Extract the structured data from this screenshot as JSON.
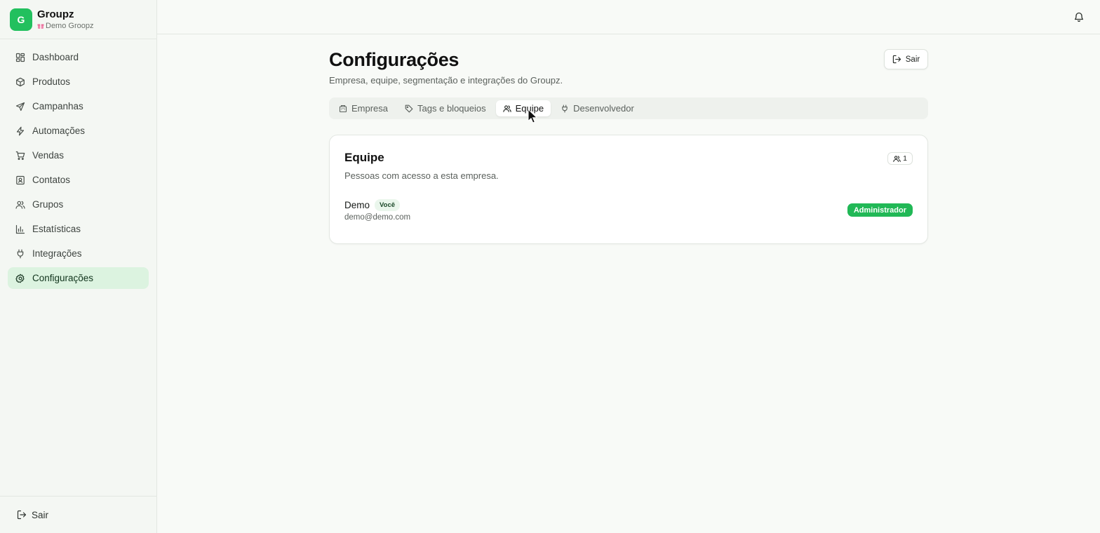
{
  "brand": {
    "logo_letter": "G",
    "name": "Groupz",
    "workspace": "Demo Groopz",
    "color": "#22c05e"
  },
  "sidebar": {
    "items": [
      {
        "label": "Dashboard",
        "icon": "dashboard-icon"
      },
      {
        "label": "Produtos",
        "icon": "package-icon"
      },
      {
        "label": "Campanhas",
        "icon": "send-icon"
      },
      {
        "label": "Automações",
        "icon": "zap-icon"
      },
      {
        "label": "Vendas",
        "icon": "cart-icon"
      },
      {
        "label": "Contatos",
        "icon": "contact-icon"
      },
      {
        "label": "Grupos",
        "icon": "users-icon"
      },
      {
        "label": "Estatísticas",
        "icon": "bar-chart-icon"
      },
      {
        "label": "Integrações",
        "icon": "plug-icon"
      },
      {
        "label": "Configurações",
        "icon": "gear-icon",
        "active": true
      }
    ],
    "footer_label": "Sair"
  },
  "page": {
    "title": "Configurações",
    "subtitle": "Empresa, equipe, segmentação e integrações do Groupz.",
    "logout_label": "Sair"
  },
  "tabs": [
    {
      "label": "Empresa",
      "icon": "building-icon"
    },
    {
      "label": "Tags e bloqueios",
      "icon": "tag-icon"
    },
    {
      "label": "Equipe",
      "icon": "users-icon",
      "active": true
    },
    {
      "label": "Desenvolvedor",
      "icon": "plug-icon"
    }
  ],
  "team": {
    "title": "Equipe",
    "description": "Pessoas com acesso a esta empresa.",
    "count": "1",
    "members": [
      {
        "name": "Demo",
        "you_label": "Você",
        "email": "demo@demo.com",
        "role": "Administrador"
      }
    ]
  }
}
